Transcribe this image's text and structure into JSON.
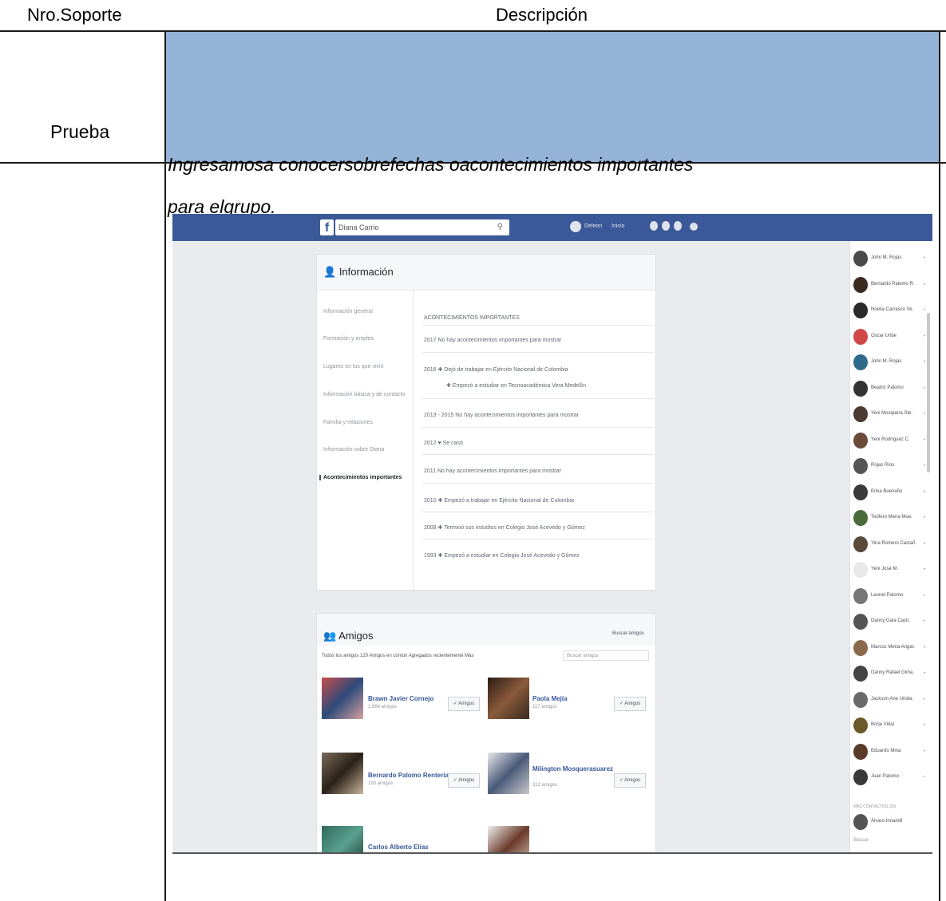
{
  "table": {
    "col1_header": "Nro.Soporte",
    "col2_header": "Descripción",
    "row_label": "Prueba",
    "desc_line1": "Ingresamosa conocersobrefechas oacontecimientos importantes",
    "desc_line2": "para elgrupo."
  },
  "colors": {
    "band": "#95b3d7",
    "fb_blue": "#3b5998"
  },
  "screenshot": {
    "logo": "f",
    "search_value": "Diana Carrio",
    "nav_profile": "Deleon",
    "nav_home": "Inicio",
    "info_title": "Información",
    "menu": [
      "Información general",
      "Formación y empleo",
      "Lugares en los que vivió",
      "Información básica y de contacto",
      "Familia y relaciones",
      "Información sobre Diana",
      "Acontecimientos importantes"
    ],
    "events_header": "ACONTECIMIENTOS IMPORTANTES",
    "events": [
      "2017   No hay acontecimientos importantes para mostrar",
      "2016   ✚ Dejó de trabajar en Ejército Nacional de Colombia",
      "✚ Empezó a estudiar en Tecnoacadémica Vera Medellín",
      "2013 - 2015   No hay acontecimientos importantes para mostrar",
      "2012   ♥ Se casó",
      "2011   No hay acontecimientos importantes para mostrar",
      "2010   ✚ Empezó a trabajar en Ejército Nacional de Colombia",
      "2009   ✚ Terminó sus estudios en Colegio José Acevedo y Gómez",
      "1993   ✚ Empezó a estudiar en Colegio José Acevedo y Gómez"
    ],
    "friends_title": "Amigos",
    "find_friends": "Buscar amigos",
    "friends_tabs": "Todos los amigos 120   Amigos en común   Agregados recientemente   Más",
    "friends_search": "Buscar amigos",
    "friends": [
      {
        "name": "Brawn Javier Cornejo",
        "sub": "1.864 amigos",
        "btn": "✓ Amigos"
      },
      {
        "name": "Paola Mejía",
        "sub": "117 amigos",
        "btn": "✓ Amigos"
      },
      {
        "name": "Bernardo Palomo Rentería",
        "sub": "193 amigos",
        "btn": "✓ Amigos"
      },
      {
        "name": "Milington Mosquerasuarez",
        "sub": "312 amigos",
        "btn": "✓ Amigos"
      },
      {
        "name": "Carlos Alberto Elías",
        "sub": "",
        "btn": ""
      }
    ],
    "chat": [
      "John M. Rojas",
      "Bernardo Palomo R.",
      "Noelia Carrasco Ve.",
      "Oscar Uribe",
      "John M. Rojas",
      "Beatriz Palomo",
      "Yeni Mosquera Ste.",
      "Yeni Rodríguez C.",
      "Rojas Ríos",
      "Erika Buenaño",
      "Teófero Mena Mue.",
      "Yina Romero Castañ.",
      "Yeni José M.",
      "Leonel Palomo",
      "Danny Gala Castr.",
      "Marcos Mena Angar.",
      "Danny Rafael Gima.",
      "Jackson Ane Unida.",
      "Borja Vidal",
      "Eduardo Mina",
      "Juan Palomo"
    ],
    "chat_more": "MÁS CONTACTOS (25)",
    "chat_last": "Álvaro Innamill",
    "chat_search": "Buscar"
  }
}
